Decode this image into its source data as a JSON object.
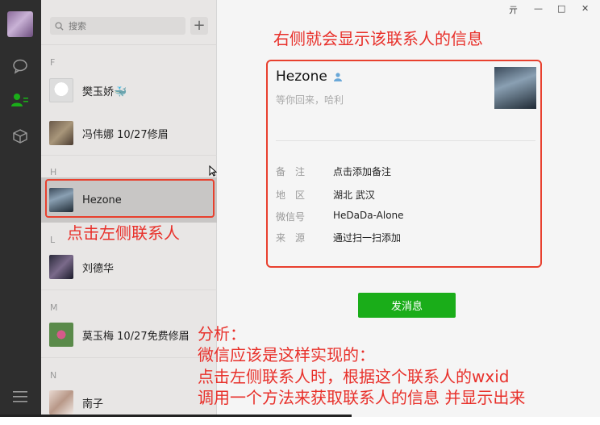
{
  "window": {
    "controls": [
      "亓",
      "—",
      "□",
      "✕"
    ]
  },
  "nav": {
    "items": [
      "chat-icon",
      "contacts-icon",
      "favorites-icon",
      "menu-icon"
    ]
  },
  "search": {
    "placeholder": "搜索",
    "add_label": "+"
  },
  "groups": [
    {
      "letter": "F"
    },
    {
      "letter": "H"
    },
    {
      "letter": "L"
    },
    {
      "letter": "M"
    },
    {
      "letter": "N"
    }
  ],
  "contacts": [
    {
      "name": "樊玉娇🐳"
    },
    {
      "name": "冯伟娜 10/27修眉"
    },
    {
      "name": "Hezone"
    },
    {
      "name": "刘德华"
    },
    {
      "name": "莫玉梅 10/27免费修眉"
    },
    {
      "name": "南子"
    }
  ],
  "profile": {
    "name": "Hezone",
    "signature": "等你回来，哈利",
    "rows": [
      {
        "label": "备　注",
        "value": "点击添加备注"
      },
      {
        "label": "地　区",
        "value": "湖北 武汉"
      },
      {
        "label": "微信号",
        "value": "HeDaDa-Alone"
      },
      {
        "label": "来　源",
        "value": "通过扫一扫添加"
      }
    ],
    "send_label": "发消息"
  },
  "annotations": {
    "top": "右侧就会显示该联系人的信息",
    "left": "点击左侧联系人",
    "analysis": [
      "分析：",
      "微信应该是这样实现的：",
      "点击左侧联系人时，根据这个联系人的wxid",
      "调用一个方法来获取联系人的信息 并显示出来"
    ]
  },
  "colors": {
    "accent_green": "#1aad19",
    "annotation_red": "#e8302a",
    "nav_bg": "#2e2e2e"
  }
}
